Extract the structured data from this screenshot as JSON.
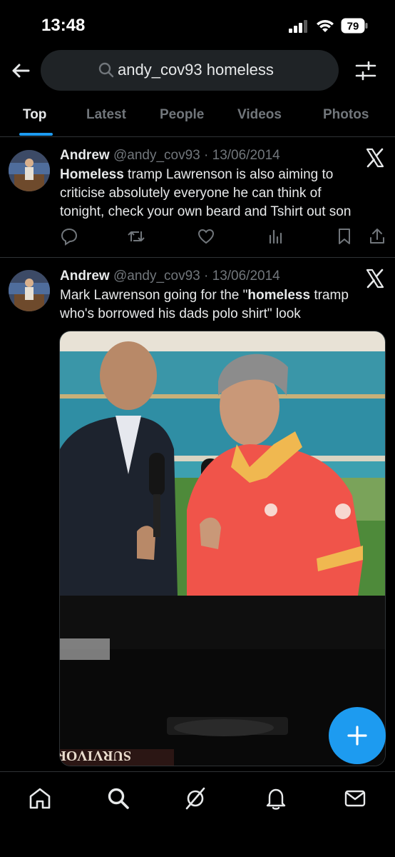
{
  "status_bar": {
    "time": "13:48",
    "battery": "79"
  },
  "search": {
    "query": "andy_cov93 homeless"
  },
  "tabs": [
    {
      "label": "Top",
      "active": true
    },
    {
      "label": "Latest"
    },
    {
      "label": "People"
    },
    {
      "label": "Videos"
    },
    {
      "label": "Photos"
    }
  ],
  "tweets": [
    {
      "name": "Andrew",
      "handle": "@andy_cov93",
      "date": "· 13/06/2014",
      "body": [
        {
          "text": "Homeless",
          "bold": true
        },
        {
          "text": " tramp Lawrenson is also aiming to criticise absolutely everyone he can think of tonight, check your own beard and Tshirt out son",
          "bold": false
        }
      ],
      "actions": [
        "reply-icon",
        "retweet-icon",
        "like-icon",
        "views-icon",
        "bookmark-icon",
        "share-icon"
      ]
    },
    {
      "name": "Andrew",
      "handle": "@andy_cov93",
      "date": "· 13/06/2014",
      "body": [
        {
          "text": "Mark Lawrenson going for the \"",
          "bold": false
        },
        {
          "text": "homeless",
          "bold": true
        },
        {
          "text": " tramp who's borrowed his dads polo shirt\" look",
          "bold": false
        }
      ],
      "media": {
        "type": "photo",
        "image_text": "SURVIVORS"
      }
    }
  ],
  "fab": {
    "icon": "compose-plus-icon"
  },
  "bottom_nav": [
    "home-icon",
    "search-icon",
    "grok-icon",
    "notifications-icon",
    "messages-icon"
  ],
  "colors": {
    "accent": "#1d9bf0",
    "background": "#000000",
    "muted": "#71767b",
    "text": "#e7e9ea"
  }
}
